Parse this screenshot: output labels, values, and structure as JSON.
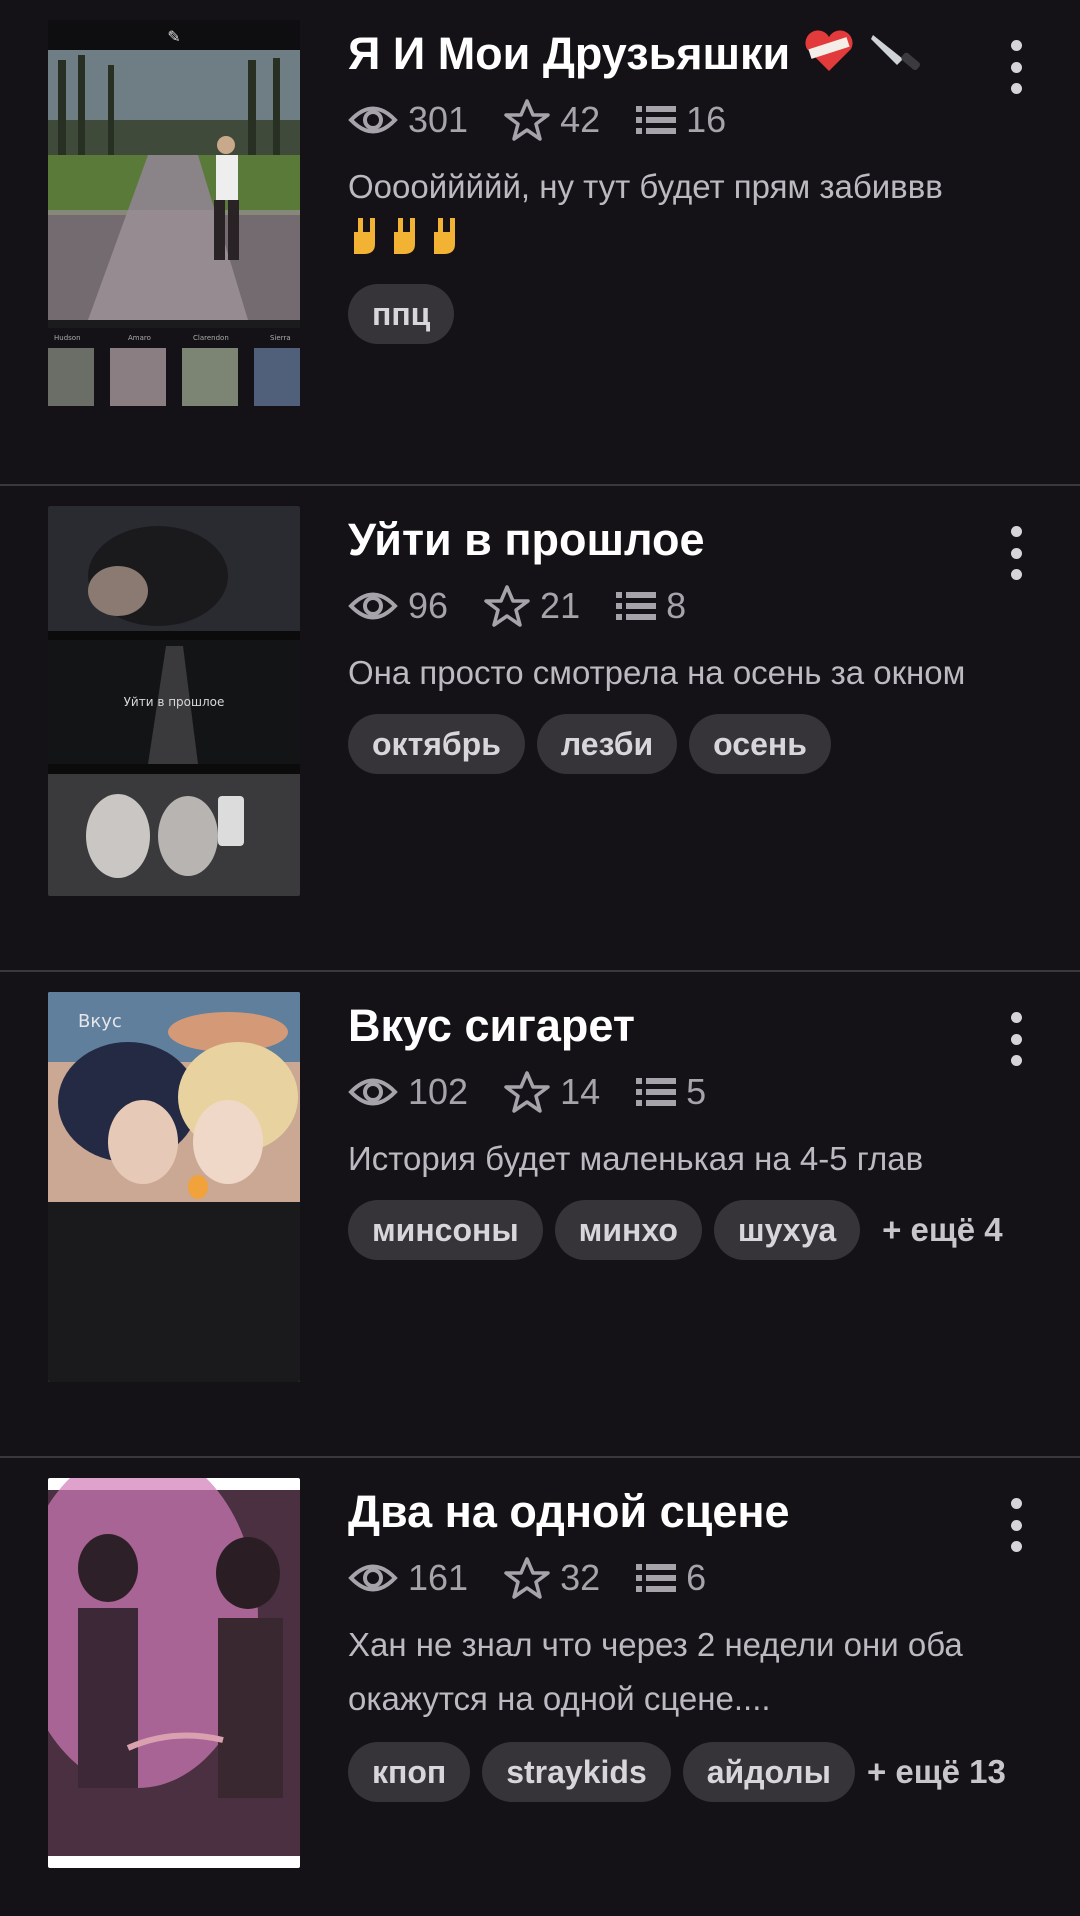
{
  "stories": [
    {
      "title": "Я И Мои Друзьяшки",
      "views": "301",
      "stars": "42",
      "chapters": "16",
      "description": "Ооооййййй, ну тут будет прям забиввв",
      "tags": [
        "ппц"
      ],
      "more": ""
    },
    {
      "title": "Уйти в прошлое",
      "views": "96",
      "stars": "21",
      "chapters": "8",
      "description": "Она просто смотрела на осень за окном",
      "tags": [
        "октябрь",
        "лезби",
        "осень"
      ],
      "more": ""
    },
    {
      "title": "Вкус сигарет",
      "views": "102",
      "stars": "14",
      "chapters": "5",
      "description": "История будет маленькая на 4-5 глав",
      "tags": [
        "минсоны",
        "минхо",
        "шухуа"
      ],
      "more": "+ ещё 4",
      "cover_text": "Вкус"
    },
    {
      "title": "Два на одной сцене",
      "views": "161",
      "stars": "32",
      "chapters": "6",
      "description": "Хан не знал что через 2 недели они оба окажутся на одной сцене....",
      "tags": [
        "кпоп",
        "straykids",
        "айдолы"
      ],
      "more": "+ ещё 13"
    }
  ],
  "cover2_caption": "Уйти в прошлое",
  "colors": {
    "background": "#141216",
    "tag_bg": "#363439",
    "muted_text": "#a6a3aa"
  }
}
